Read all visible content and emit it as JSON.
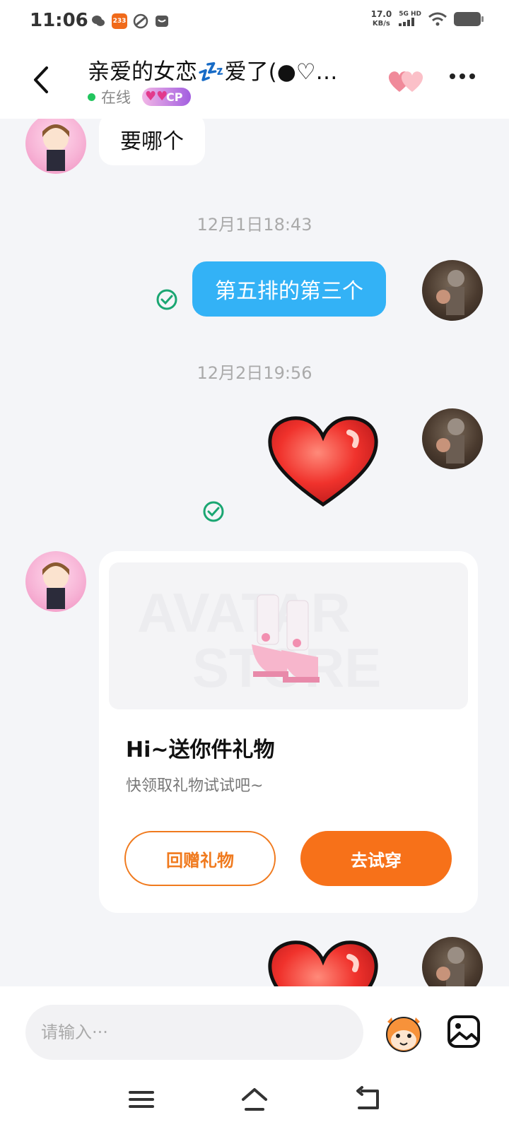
{
  "status_bar": {
    "time": "11:06",
    "badge_233": "233",
    "speed_value": "17.0",
    "speed_unit": "KB/s",
    "network": "5G HD"
  },
  "header": {
    "title": "亲爱的女恋💤爱了(●♡…",
    "status_text": "在线",
    "cp_badge": "CP",
    "icons": {
      "back": "back-arrow-icon",
      "hearts": "hearts-icon",
      "more": "more-icon"
    }
  },
  "messages": [
    {
      "side": "left",
      "type": "text",
      "text": "要哪个"
    },
    {
      "type": "timestamp",
      "text": "12月1日18:43"
    },
    {
      "side": "right",
      "type": "text",
      "text": "第五排的第三个",
      "status": "read"
    },
    {
      "type": "timestamp",
      "text": "12月2日19:56"
    },
    {
      "side": "right",
      "type": "sticker",
      "sticker": "red-heart",
      "status": "read"
    },
    {
      "side": "left",
      "type": "gift_card",
      "watermark_line1": "AVATAR",
      "watermark_line2": "STORE",
      "title": "Hi~送你件礼物",
      "subtitle": "快领取礼物试试吧~",
      "secondary_button": "回赠礼物",
      "primary_button": "去试穿"
    },
    {
      "side": "right",
      "type": "sticker",
      "sticker": "red-heart"
    }
  ],
  "input": {
    "placeholder": "请输入···",
    "value": ""
  },
  "colors": {
    "accent_blue": "#33b2f6",
    "accent_orange": "#f77119",
    "online_green": "#22c55e",
    "read_check_green": "#1aa672"
  }
}
